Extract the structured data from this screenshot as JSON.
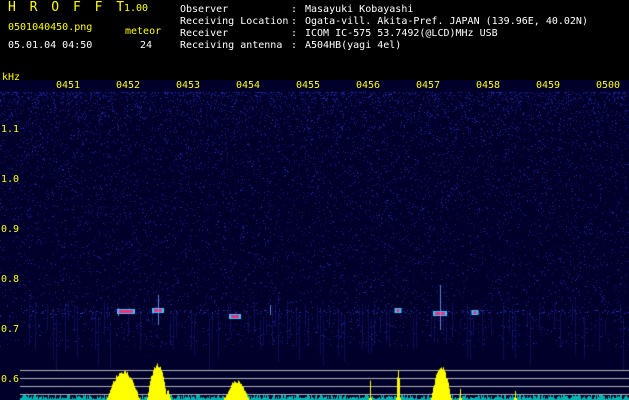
{
  "app": {
    "title": "H R O F F T",
    "version": "1.00"
  },
  "file": {
    "name": "0501040450.png",
    "datetime": "05.01.04 04:50"
  },
  "meteor": {
    "label": "meteor",
    "count": "24"
  },
  "meta": [
    {
      "key": "Observer",
      "value": "Masayuki Kobayashi"
    },
    {
      "key": "Receiving Location",
      "value": "Ogata-vill. Akita-Pref. JAPAN (139.96E, 40.02N)"
    },
    {
      "key": "Receiver",
      "value": "ICOM IC-575 53.7492(@LCD)MHz USB"
    },
    {
      "key": "Receiving antenna",
      "value": "A504HB(yagi 4el)"
    }
  ],
  "meta_separator": ":",
  "spectrogram": {
    "unit": "kHz",
    "time_ticks": [
      "0451",
      "0452",
      "0453",
      "0454",
      "0455",
      "0456",
      "0457",
      "0458",
      "0459",
      "0500"
    ],
    "freq_ticks": [
      "1.1",
      "1.0",
      "0.9",
      "0.8",
      "0.7",
      "0.6"
    ],
    "colors": {
      "background": "#00002a",
      "noise": "#2828c8",
      "grid": "#b4b4b4",
      "label": "#ffff00",
      "echo": "#ff2878",
      "echo_edge": "#32c8ff",
      "meter_high": "#ffff00",
      "meter_low": "#00b4b4"
    }
  }
}
